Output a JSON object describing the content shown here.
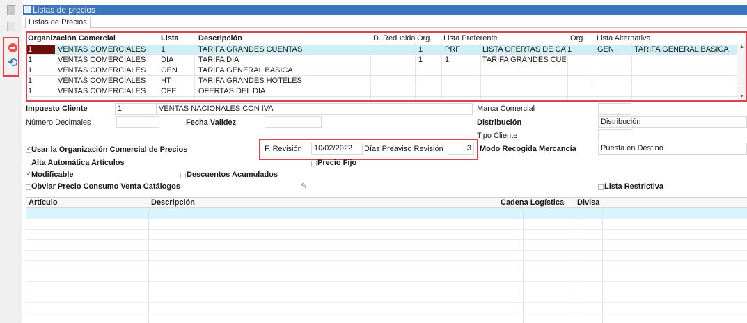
{
  "window": {
    "title": "Listas de precios",
    "tab": "Listas de Precios"
  },
  "grid1": {
    "headers": {
      "org": "Organización Comercial",
      "lista": "Lista",
      "descripcion": "Descripción",
      "d_reducida": "D. Reducida",
      "org2": "Org.",
      "lista_pref": "Lista Preferente",
      "org3": "Org.",
      "lista_alt": "Lista Alternativa"
    },
    "rows": [
      {
        "org_code": "1",
        "org_name": "VENTAS COMERCIALES",
        "lista": "1",
        "descripcion": "TARIFA GRANDES CUENTAS",
        "org2": "1",
        "pref_code": "PRF",
        "pref_desc": "LISTA OFERTAS DE CAT",
        "org3": "1",
        "alt_code": "GEN",
        "alt_desc": "TARIFA GENERAL BASICA"
      },
      {
        "org_code": "1",
        "org_name": "VENTAS COMERCIALES",
        "lista": "DIA",
        "descripcion": "TARIFA DIA",
        "org2": "1",
        "pref_code": "1",
        "pref_desc": "TARIFA GRANDES CUEN",
        "org3": "",
        "alt_code": "",
        "alt_desc": ""
      },
      {
        "org_code": "1",
        "org_name": "VENTAS COMERCIALES",
        "lista": "GEN",
        "descripcion": "TARIFA GENERAL BASICA",
        "org2": "",
        "pref_code": "",
        "pref_desc": "",
        "org3": "",
        "alt_code": "",
        "alt_desc": ""
      },
      {
        "org_code": "1",
        "org_name": "VENTAS COMERCIALES",
        "lista": "HT",
        "descripcion": "TARIFA GRANDES HOTELES",
        "org2": "",
        "pref_code": "",
        "pref_desc": "",
        "org3": "",
        "alt_code": "",
        "alt_desc": ""
      },
      {
        "org_code": "1",
        "org_name": "VENTAS COMERCIALES",
        "lista": "OFE",
        "descripcion": "OFERTAS DEL DIA",
        "org2": "",
        "pref_code": "",
        "pref_desc": "",
        "org3": "",
        "alt_code": "",
        "alt_desc": ""
      }
    ]
  },
  "form": {
    "impuesto_label": "Impuesto Cliente",
    "impuesto_code": "1",
    "impuesto_desc": "VENTAS NACIONALES CON IVA",
    "marca_label": "Marca Comercial",
    "num_dec_label": "Número Decimales",
    "fecha_validez_label": "Fecha Validez",
    "distribucion_label": "Distribución",
    "distribucion_value": "Distribución",
    "tipo_cliente_label": "Tipo Cliente",
    "usar_org_label": "Usar la Organización Comercial de Precios",
    "f_revision_label": "F. Revisión",
    "f_revision_value": "10/02/2022",
    "dias_preaviso_label": "Días Preaviso Revisión",
    "dias_preaviso_value": "3",
    "modo_recogida_label": "Modo Recogida Mercancía",
    "modo_recogida_value": "Puesta en Destino",
    "alta_auto_label": "Alta Automática Artículos",
    "precio_fijo_label": "Precio Fijo",
    "modificable_label": "Modificable",
    "descuentos_label": "Descuentos Acumulados",
    "obviar_label": "Obviar Precio Consumo Venta Catálogos",
    "lista_restrictiva_label": "Lista Restrictiva"
  },
  "grid2": {
    "headers": {
      "articulo": "Artículo",
      "descripcion": "Descripción",
      "cadena": "Cadena Logística",
      "divisa": "Divisa"
    }
  },
  "icons": [
    "document-icon",
    "document-icon",
    "delete-icon",
    "refresh-icon",
    "window-icon",
    "cursor-icon"
  ],
  "colors": {
    "titlebar": "#3c75c0",
    "highlight": "#e0414f",
    "selected_row": "#cfeff6",
    "marked_cell": "#6b0d0d"
  }
}
